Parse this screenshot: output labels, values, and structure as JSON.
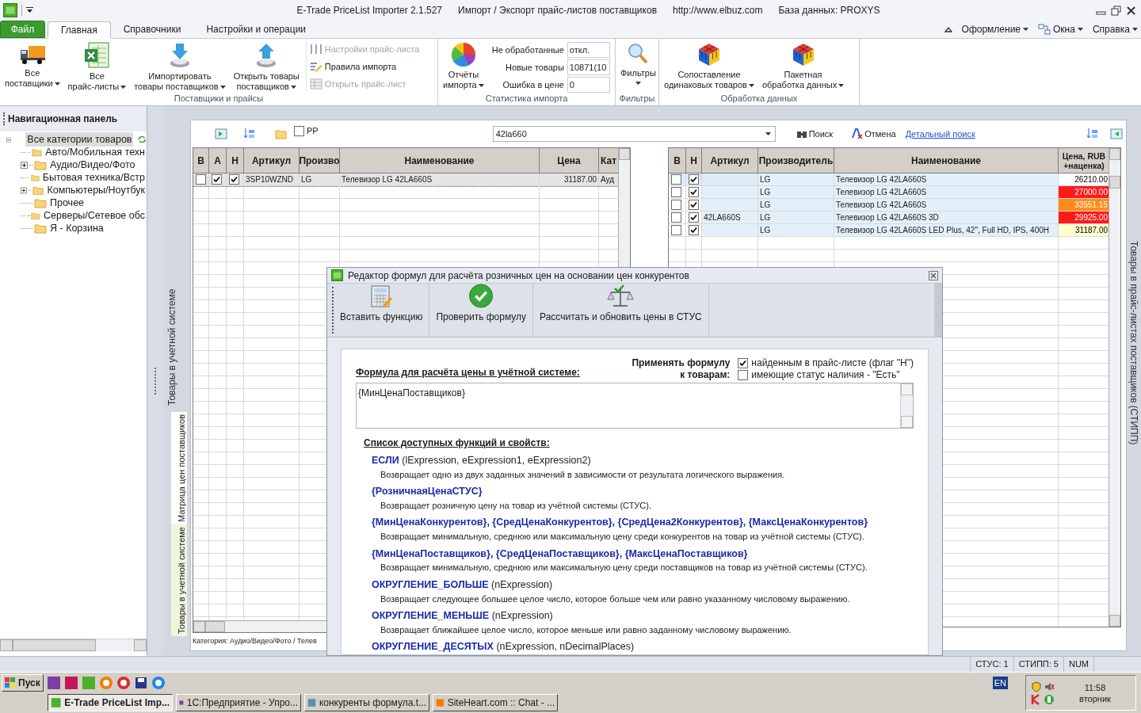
{
  "window": {
    "title": "E-Trade PriceList Importer 2.1.527",
    "subtitle": "Импорт / Экспорт прайс-листов поставщиков",
    "url": "http://www.elbuz.com",
    "database": "База данных: PROXYS"
  },
  "ribbon": {
    "tabs": [
      {
        "label": "Файл",
        "kind": "file",
        "selected": false
      },
      {
        "label": "Главная",
        "kind": "tab",
        "selected": true
      },
      {
        "label": "Справочники",
        "kind": "tab",
        "selected": false
      },
      {
        "label": "Настройки и операции",
        "kind": "tab",
        "selected": false
      }
    ],
    "menus": [
      "Оформление",
      "Окна",
      "Справка"
    ],
    "groups": [
      {
        "title": "Поставщики и прайсы",
        "items": [
          {
            "kind": "large",
            "lines": [
              "Все",
              "поставщики"
            ],
            "dropdown": true
          },
          {
            "kind": "large",
            "lines": [
              "Все",
              "прайс-листы"
            ],
            "dropdown": true
          },
          {
            "kind": "large",
            "lines": [
              "Импортировать",
              "товары поставщиков"
            ],
            "dropdown": true
          },
          {
            "kind": "large",
            "lines": [
              "Открыть товары",
              "поставщиков"
            ],
            "dropdown": true
          },
          {
            "kind": "small_stack",
            "buttons": [
              {
                "label": "Настройки прайс-листа",
                "disabled": true
              },
              {
                "label": "Правила импорта",
                "disabled": false
              },
              {
                "label": "Открыть прайс-лист",
                "disabled": true
              }
            ]
          }
        ]
      },
      {
        "title": "Статистика импорта",
        "items": [
          {
            "kind": "large",
            "lines": [
              "Отчёты",
              "импорта"
            ],
            "dropdown": true
          },
          {
            "kind": "stats",
            "fields": [
              {
                "label": "Не обработанные",
                "value": "откл."
              },
              {
                "label": "Новые товары",
                "value": "10871(10"
              },
              {
                "label": "Ошибка в цене",
                "value": "0"
              }
            ]
          }
        ]
      },
      {
        "title": "Фильтры",
        "items": [
          {
            "kind": "large",
            "lines": [
              "Фильтры"
            ],
            "dropdown": true
          }
        ]
      },
      {
        "title": "Обработка данных",
        "items": [
          {
            "kind": "large",
            "lines": [
              "Сопоставление",
              "одинаковых товаров"
            ],
            "dropdown": true
          },
          {
            "kind": "large",
            "lines": [
              "Пакетная",
              "обработка данных"
            ],
            "dropdown": true
          }
        ]
      }
    ]
  },
  "nav": {
    "title": "Навигационная панель",
    "tree": [
      {
        "label": "Все категории товаров",
        "selected": true,
        "expanded": true,
        "children": [
          {
            "label": "Авто/Мобильная техн",
            "selected": false,
            "expandable": false
          },
          {
            "label": "Аудио/Видео/Фото",
            "selected": false,
            "expandable": true
          },
          {
            "label": "Бытовая техника/Встр",
            "selected": false,
            "expandable": false
          },
          {
            "label": "Компьютеры/Ноутбук",
            "selected": false,
            "expandable": true
          },
          {
            "label": "Прочее",
            "selected": false,
            "expandable": false
          },
          {
            "label": "Серверы/Сетевое обс",
            "selected": false,
            "expandable": false
          },
          {
            "label": "Я - Корзина",
            "selected": false,
            "expandable": false
          }
        ]
      }
    ]
  },
  "content": {
    "left_caption": "Товары в учетной системе",
    "side_tabs": [
      {
        "label": "Матрица цен поставщиков",
        "selected": true
      },
      {
        "label": "Товары в учетной системе",
        "selected": false
      }
    ],
    "right_caption": "Товары в прайс-листах поставщиков (СТИПП)",
    "toolbar": {
      "pp_checkbox": {
        "label": "РР",
        "checked": false
      },
      "search": {
        "value": "42la660"
      },
      "search_button": "Поиск",
      "cancel_button": "Отмена",
      "detail_link": "Детальный поиск"
    },
    "left_table": {
      "columns": [
        "В",
        "А",
        "Н",
        "Артикул",
        "Произво",
        "Наименование",
        "Цена",
        "Кат"
      ],
      "rows": [
        {
          "selected": true,
          "b": false,
          "a": true,
          "h": true,
          "article": "3SP10WZND",
          "maker": "LG",
          "name": "Телевизор LG 42LA660S",
          "price": "31187.00",
          "category": "Ауд"
        }
      ],
      "footer": "Категория: Аудио/Видео/Фото / Телев"
    },
    "right_table": {
      "columns": [
        "В",
        "Н",
        "Артикул",
        "Производитель",
        "Наименование",
        "Цена, RUB +наценка)"
      ],
      "rows": [
        {
          "selected": true,
          "b": false,
          "h": true,
          "maker": "LG",
          "name": "Телевизор LG 42LA660S",
          "price": "26210.00",
          "color": "#ffffff"
        },
        {
          "selected": false,
          "b": false,
          "h": true,
          "maker": "LG",
          "name": "Телевизор LG 42LA660S",
          "price": "27000.00",
          "color": "#ff1a1a"
        },
        {
          "selected": false,
          "b": false,
          "h": true,
          "maker": "LG",
          "name": "Телевизор LG 42LA660S",
          "price": "33551.15",
          "color": "#ff8c1a"
        },
        {
          "selected": false,
          "b": false,
          "h": true,
          "article": "42LA660S",
          "maker": "LG",
          "name": "Телевизор LG 42LA660S 3D",
          "price": "29925.00",
          "color": "#ff1a1a"
        },
        {
          "selected": false,
          "b": false,
          "h": true,
          "maker": "LG",
          "name": "Телевизор LG 42LA660S LED Plus, 42\", Full HD, IPS, 400H",
          "price": "31187.00",
          "color": "#ffffcc"
        }
      ]
    }
  },
  "dialog": {
    "title": "Редактор формул для расчёта розничных цен на основании цен конкурентов",
    "toolbar": [
      "Вставить функцию",
      "Проверить формулу",
      "Рассчитать и обновить цены в СТУС"
    ],
    "formula_label": "Формула для расчёта цены в учётной системе:",
    "apply_label": [
      "Применять формулу",
      "к товарам:"
    ],
    "apply_options": [
      {
        "label": "найденным в прайс-листе (флаг \"Н\")",
        "checked": true
      },
      {
        "label": "имеющие статус наличия - \"Есть\"",
        "checked": false
      }
    ],
    "formula": "{МинЦенаПоставщиков}",
    "functions_title": "Список доступных функций и свойств:",
    "functions": [
      {
        "name": "ЕСЛИ",
        "args": "(lExpression, eExpression1, eExpression2)",
        "description": "Возвращает одно из двух заданных значений в зависимости от результата логического выражения."
      },
      {
        "name": "{РозничнаяЦенаСТУС}",
        "description": "Возвращает розничную цену на товар из учётной системы (СТУС)."
      },
      {
        "name": "{МинЦенаКонкурентов}, {СредЦенаКонкурентов}, {СредЦена2Конкурентов}, {МаксЦенаКонкурентов}",
        "description": "Возвращает минимальную, среднюю или максимальную цену среди конкурентов на товар из учётной системы (СТУС)."
      },
      {
        "name": "{МинЦенаПоставщиков}, {СредЦенаПоставщиков}, {МаксЦенаПоставщиков}",
        "description": "Возвращает минимальную, среднюю или максимальную цену среди поставщиков на товар из учётной системы (СТУС)."
      },
      {
        "name": "ОКРУГЛЕНИЕ_БОЛЬШЕ",
        "args": "(nExpression)",
        "description": "Возвращает следующее большее целое число, которое больше чем или равно указанному числовому выражению."
      },
      {
        "name": "ОКРУГЛЕНИЕ_МЕНЬШЕ",
        "args": "(nExpression)",
        "description": "Возвращает ближайшее целое число, которое меньше или равно заданному числовому выражению."
      },
      {
        "name": "ОКРУГЛЕНИЕ_ДЕСЯТЫХ",
        "args": "(nExpression, nDecimalPlaces)"
      }
    ]
  },
  "status_bar": [
    "СТУС: 1",
    "СТИПП: 5",
    "NUM"
  ],
  "taskbar": {
    "start": "Пуск",
    "tasks": [
      {
        "label": "E-Trade PriceList Imp...",
        "selected": true
      },
      {
        "label": "1С:Предприятие - Упро...",
        "selected": false
      },
      {
        "label": "конкуренты формула.t...",
        "selected": false
      },
      {
        "label": "SiteHeart.com :: Chat - ...",
        "selected": false
      }
    ],
    "language": "EN",
    "time": "11:58",
    "day": "вторник"
  }
}
